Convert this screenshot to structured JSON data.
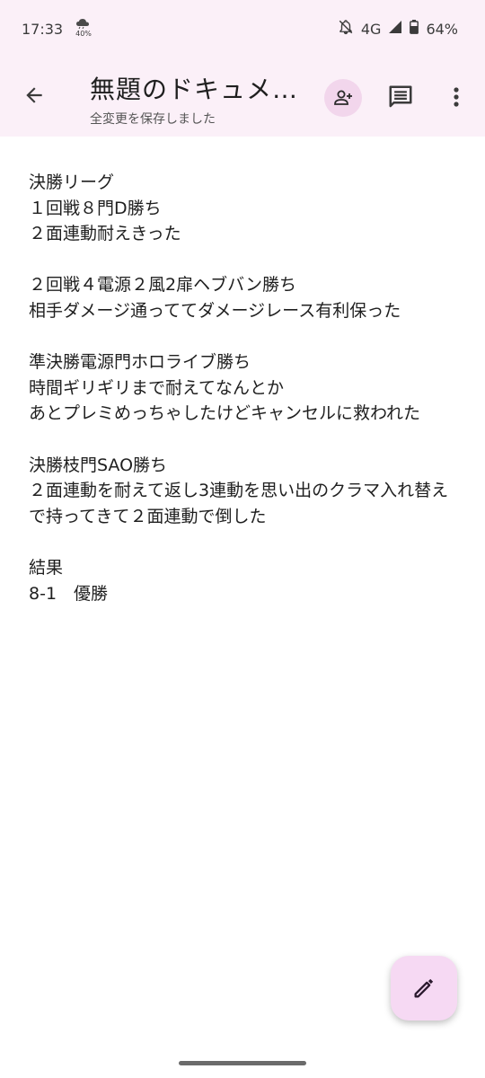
{
  "status_bar": {
    "time": "17:33",
    "weather_temp": "40%",
    "network": "4G",
    "battery": "64%"
  },
  "app_bar": {
    "title": "無題のドキュメ…",
    "save_status": "全変更を保存しました"
  },
  "document": {
    "lines": [
      "決勝リーグ",
      "１回戦８門D勝ち",
      "２面連動耐えきった",
      "",
      "２回戦４電源２風2扉ヘブバン勝ち",
      "相手ダメージ通っててダメージレース有利保った",
      "",
      "準決勝電源門ホロライブ勝ち",
      "時間ギリギリまで耐えてなんとか",
      "あとプレミめっちゃしたけどキャンセルに救われた",
      "",
      "決勝枝門SAO勝ち",
      "２面連動を耐えて返し3連動を思い出のクラマ入れ替えで持ってきて２面連動で倒した",
      "",
      "結果",
      "8-1　優勝"
    ]
  },
  "colors": {
    "app_bar_bg": "#fbf0f8",
    "share_bg": "#f2d6ec",
    "fab_bg": "#f6d9f3"
  }
}
